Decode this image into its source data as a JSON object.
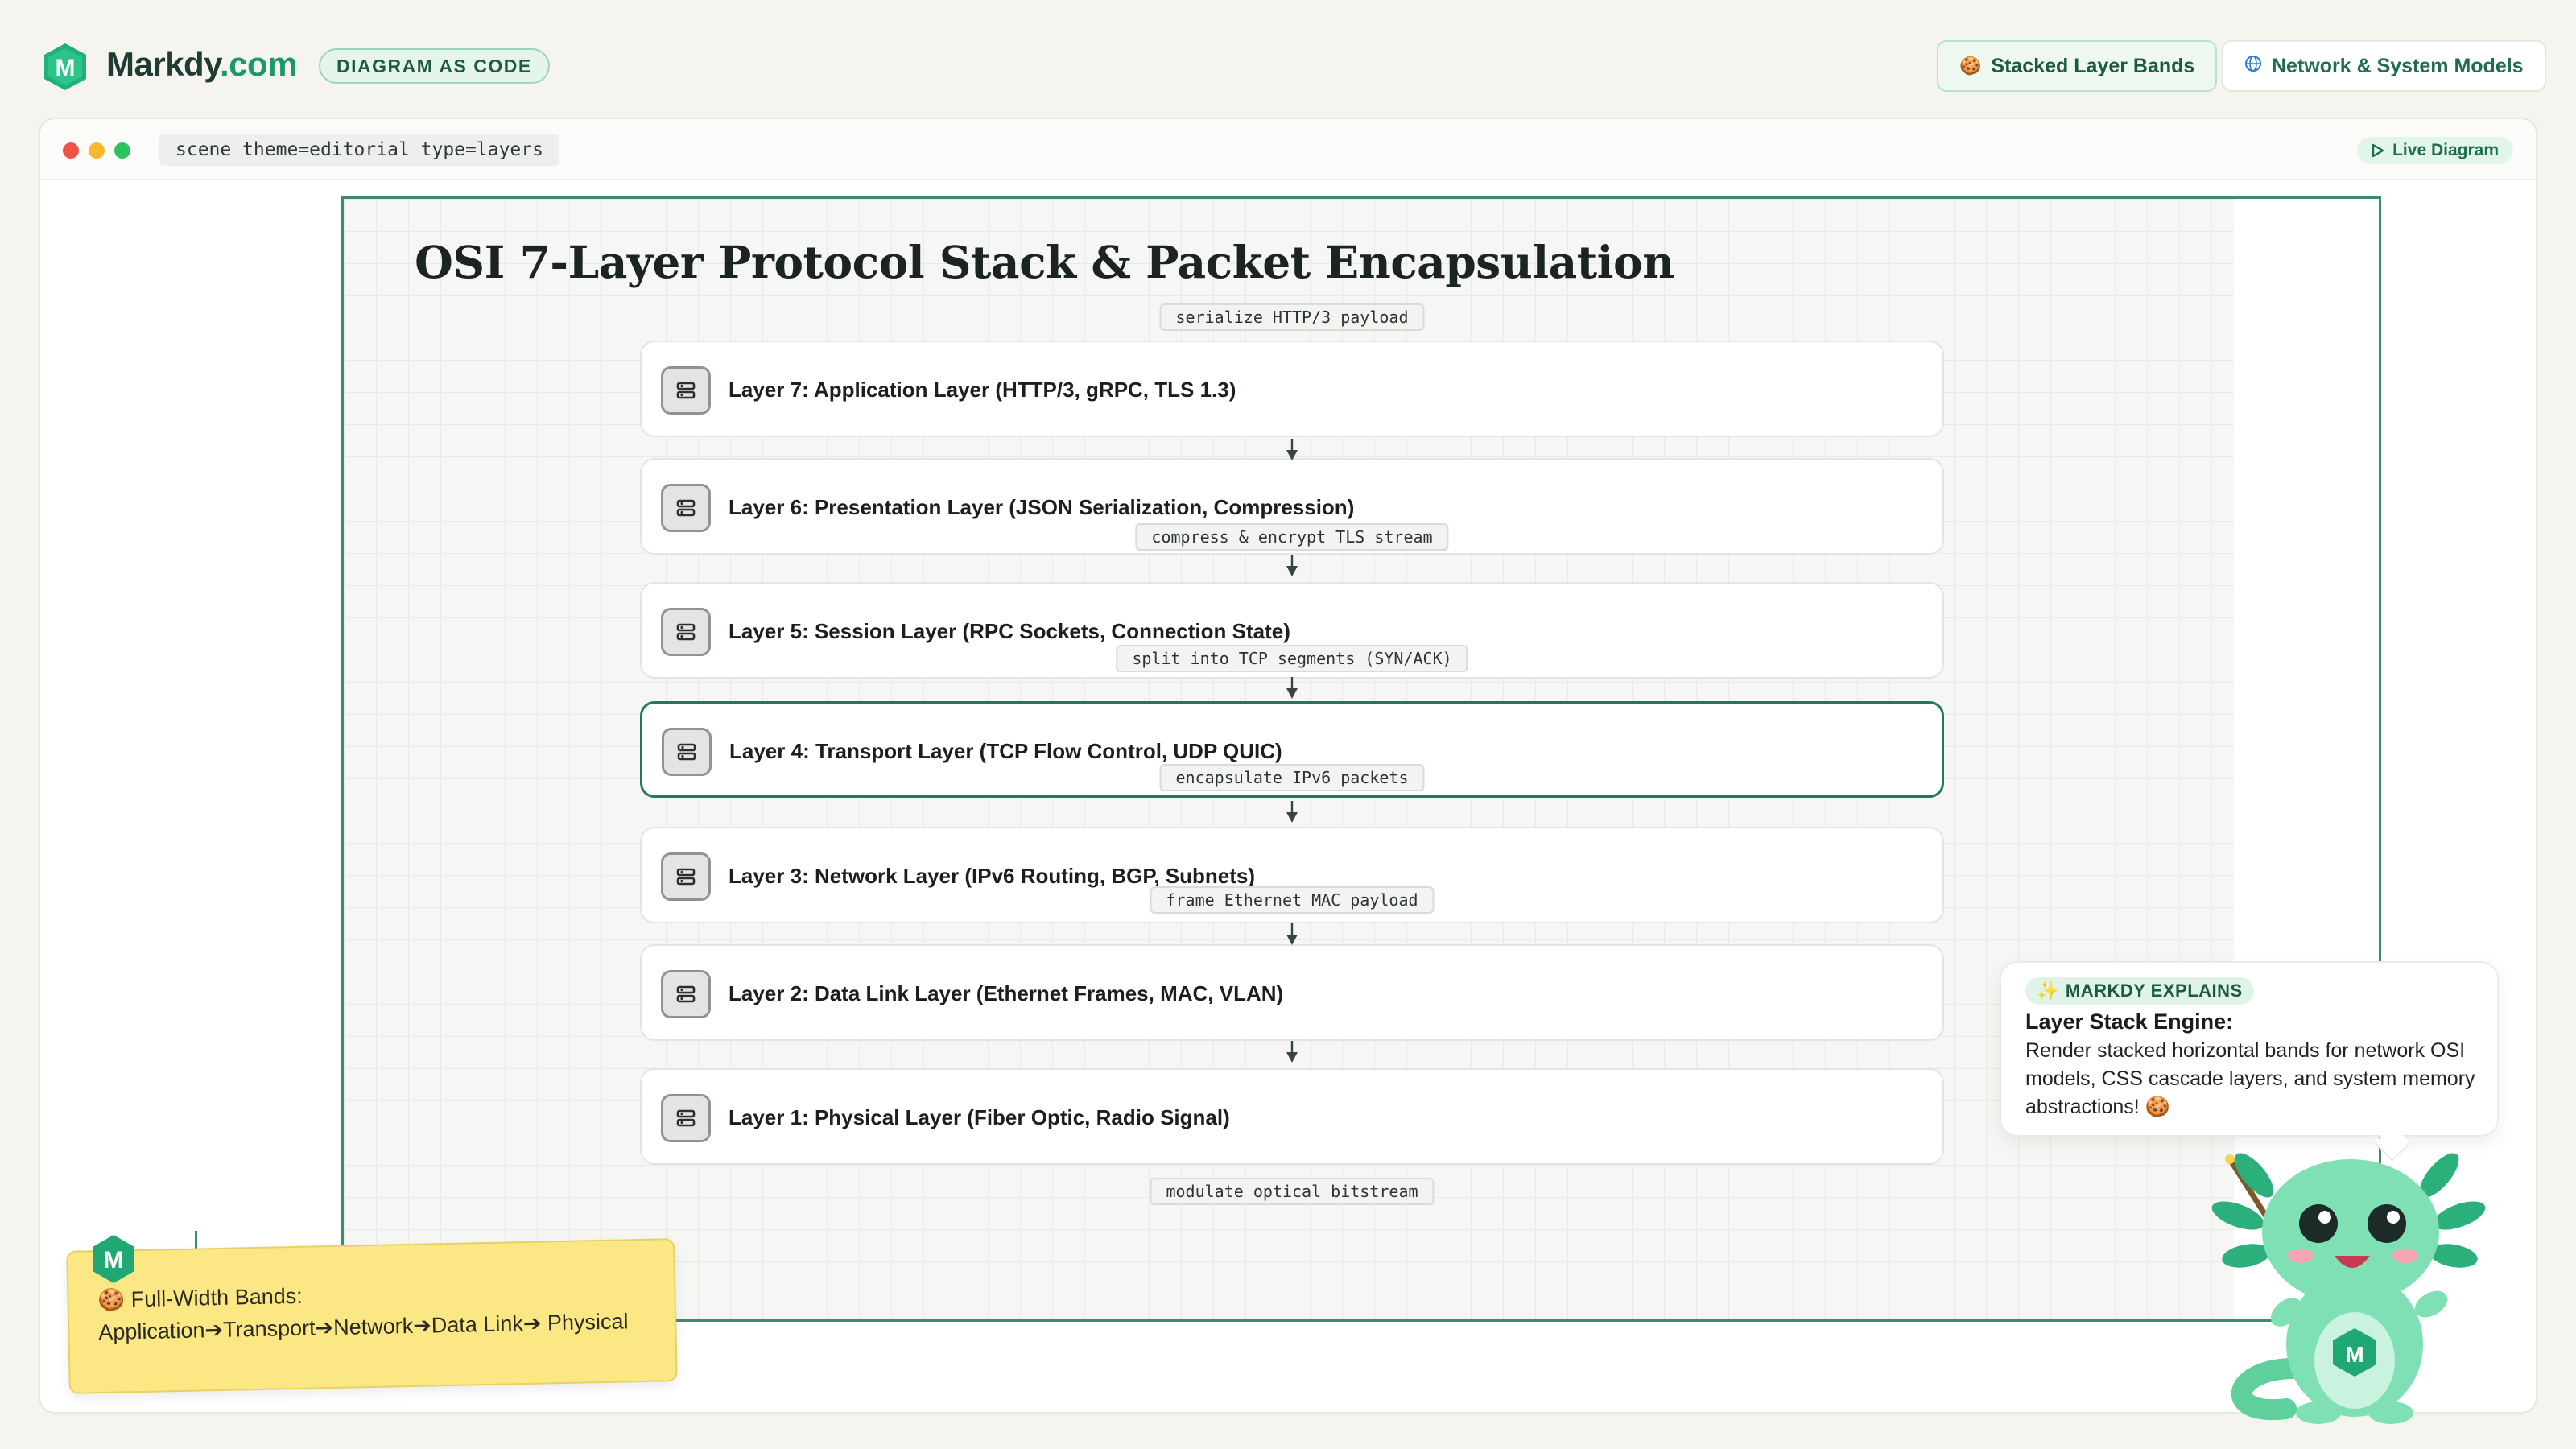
{
  "brand": {
    "name_main": "Markdy",
    "name_suffix": ".com",
    "logo_letter": "M",
    "tag": "DIAGRAM AS CODE"
  },
  "nav": {
    "items": [
      {
        "label": "Stacked Layer Bands",
        "icon": "cookie-icon",
        "glyph": "🍪"
      },
      {
        "label": "Network & System Models",
        "icon": "globe-icon",
        "glyph": "🌐"
      }
    ]
  },
  "window": {
    "scene": "scene theme=editorial type=layers",
    "live_label": "Live Diagram"
  },
  "diagram": {
    "title": "OSI 7-Layer Protocol Stack & Packet Encapsulation",
    "layers": [
      {
        "label": "Layer 7: Application Layer (HTTP/3, gRPC, TLS 1.3)",
        "active": false
      },
      {
        "label": "Layer 6: Presentation Layer (JSON Serialization, Compression)",
        "active": false
      },
      {
        "label": "Layer 5: Session Layer (RPC Sockets, Connection State)",
        "active": false
      },
      {
        "label": "Layer 4: Transport Layer (TCP Flow Control, UDP QUIC)",
        "active": true
      },
      {
        "label": "Layer 3: Network Layer (IPv6 Routing, BGP, Subnets)",
        "active": false
      },
      {
        "label": "Layer 2: Data Link Layer (Ethernet Frames, MAC, VLAN)",
        "active": false
      },
      {
        "label": "Layer 1: Physical Layer (Fiber Optic, Radio Signal)",
        "active": false
      }
    ],
    "edge_labels": [
      "serialize HTTP/3 payload",
      "compress & encrypt TLS stream",
      "split into TCP segments (SYN/ACK)",
      "encapsulate IPv6 packets",
      "frame Ethernet MAC payload",
      "modulate optical bitstream"
    ]
  },
  "sticky": {
    "icon": "cookie-icon",
    "glyph": "🍪",
    "text": "Full-Width Bands: Application➔Transport➔Network➔Data Link➔ Physical"
  },
  "explain": {
    "tag": "MARKDY EXPLAINS",
    "tag_glyph": "✨",
    "title": "Layer Stack Engine:",
    "body": "Render stacked horizontal bands for network OSI models, CSS cascade layers, and system memory abstractions! 🍪"
  },
  "colors": {
    "accent": "#1f7a5c",
    "brand_green": "#1a9a6a",
    "canvas_border": "#3f8a72",
    "sticky": "#fbe884"
  }
}
